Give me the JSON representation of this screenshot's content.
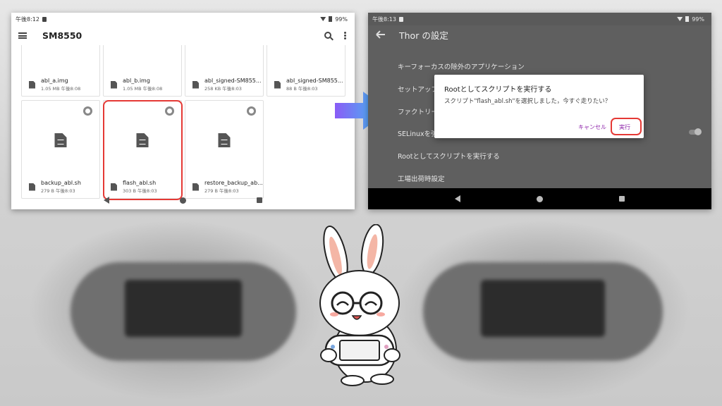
{
  "left_phone": {
    "status_time": "午後8:12",
    "battery": "99%",
    "title": "SM8550",
    "files_top": [
      {
        "name": "abl_a.img",
        "meta": "1.05 MB 午後8:08"
      },
      {
        "name": "abl_b.img",
        "meta": "1.05 MB 午後8:08"
      },
      {
        "name": "abl_signed-SM855...",
        "meta": "258 KB 午後8:03"
      },
      {
        "name": "abl_signed-SM855...",
        "meta": "88 B 午後8:03"
      }
    ],
    "files_bottom": [
      {
        "name": "backup_abl.sh",
        "meta": "279 B 午後8:03"
      },
      {
        "name": "flash_abl.sh",
        "meta": "303 B 午後8:03"
      },
      {
        "name": "restore_backup_ab...",
        "meta": "279 B 午後8:03"
      }
    ]
  },
  "right_phone": {
    "status_time": "午後8:13",
    "battery": "99%",
    "title": "Thor の設定",
    "settings": [
      "キーフォーカスの除外のアプリケーション",
      "セットアップ",
      "ファクトリー",
      "SELinuxを強",
      "Rootとしてスクリプトを実行する",
      "工場出荷時設定"
    ],
    "dialog": {
      "title": "Rootとしてスクリプトを実行する",
      "message": "スクリプト\"flash_abl.sh\"を選択しました，今すぐ走りたい？",
      "cancel": "キャンセル",
      "run": "実行"
    }
  },
  "colors": {
    "highlight": "#e53935",
    "dialog_button": "#8e24aa",
    "arrow_start": "#8a5cf6",
    "arrow_end": "#38c8f0"
  }
}
